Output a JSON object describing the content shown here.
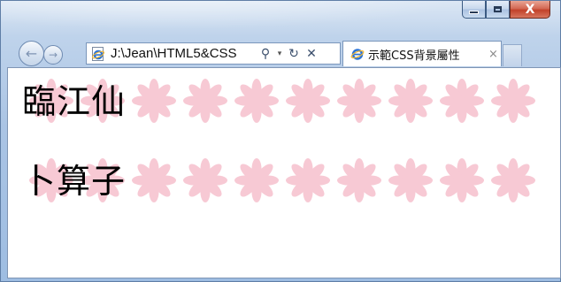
{
  "window": {
    "controls": {
      "minimize_icon": "minimize-icon",
      "maximize_icon": "maximize-icon",
      "close_glyph": "X"
    }
  },
  "nav": {
    "back_glyph": "←",
    "forward_glyph": "→"
  },
  "address": {
    "value": "J:\\Jean\\HTML5&CSS",
    "search_glyph": "⚲",
    "dropdown_glyph": "▾",
    "refresh_glyph": "↻",
    "stop_glyph": "✕"
  },
  "tab": {
    "title": "示範CSS背景屬性",
    "close_glyph": "×"
  },
  "content": {
    "lines": [
      {
        "text": "臨江仙"
      },
      {
        "text": "卜算子"
      }
    ],
    "background_pattern": "pink-asterisk-flower",
    "flower_color": "#f7c9d4",
    "flowers_per_row": 10
  },
  "colors": {
    "ie_blue": "#2a73d6",
    "ie_ring": "#f2b731",
    "close_red": "#c2412a"
  }
}
